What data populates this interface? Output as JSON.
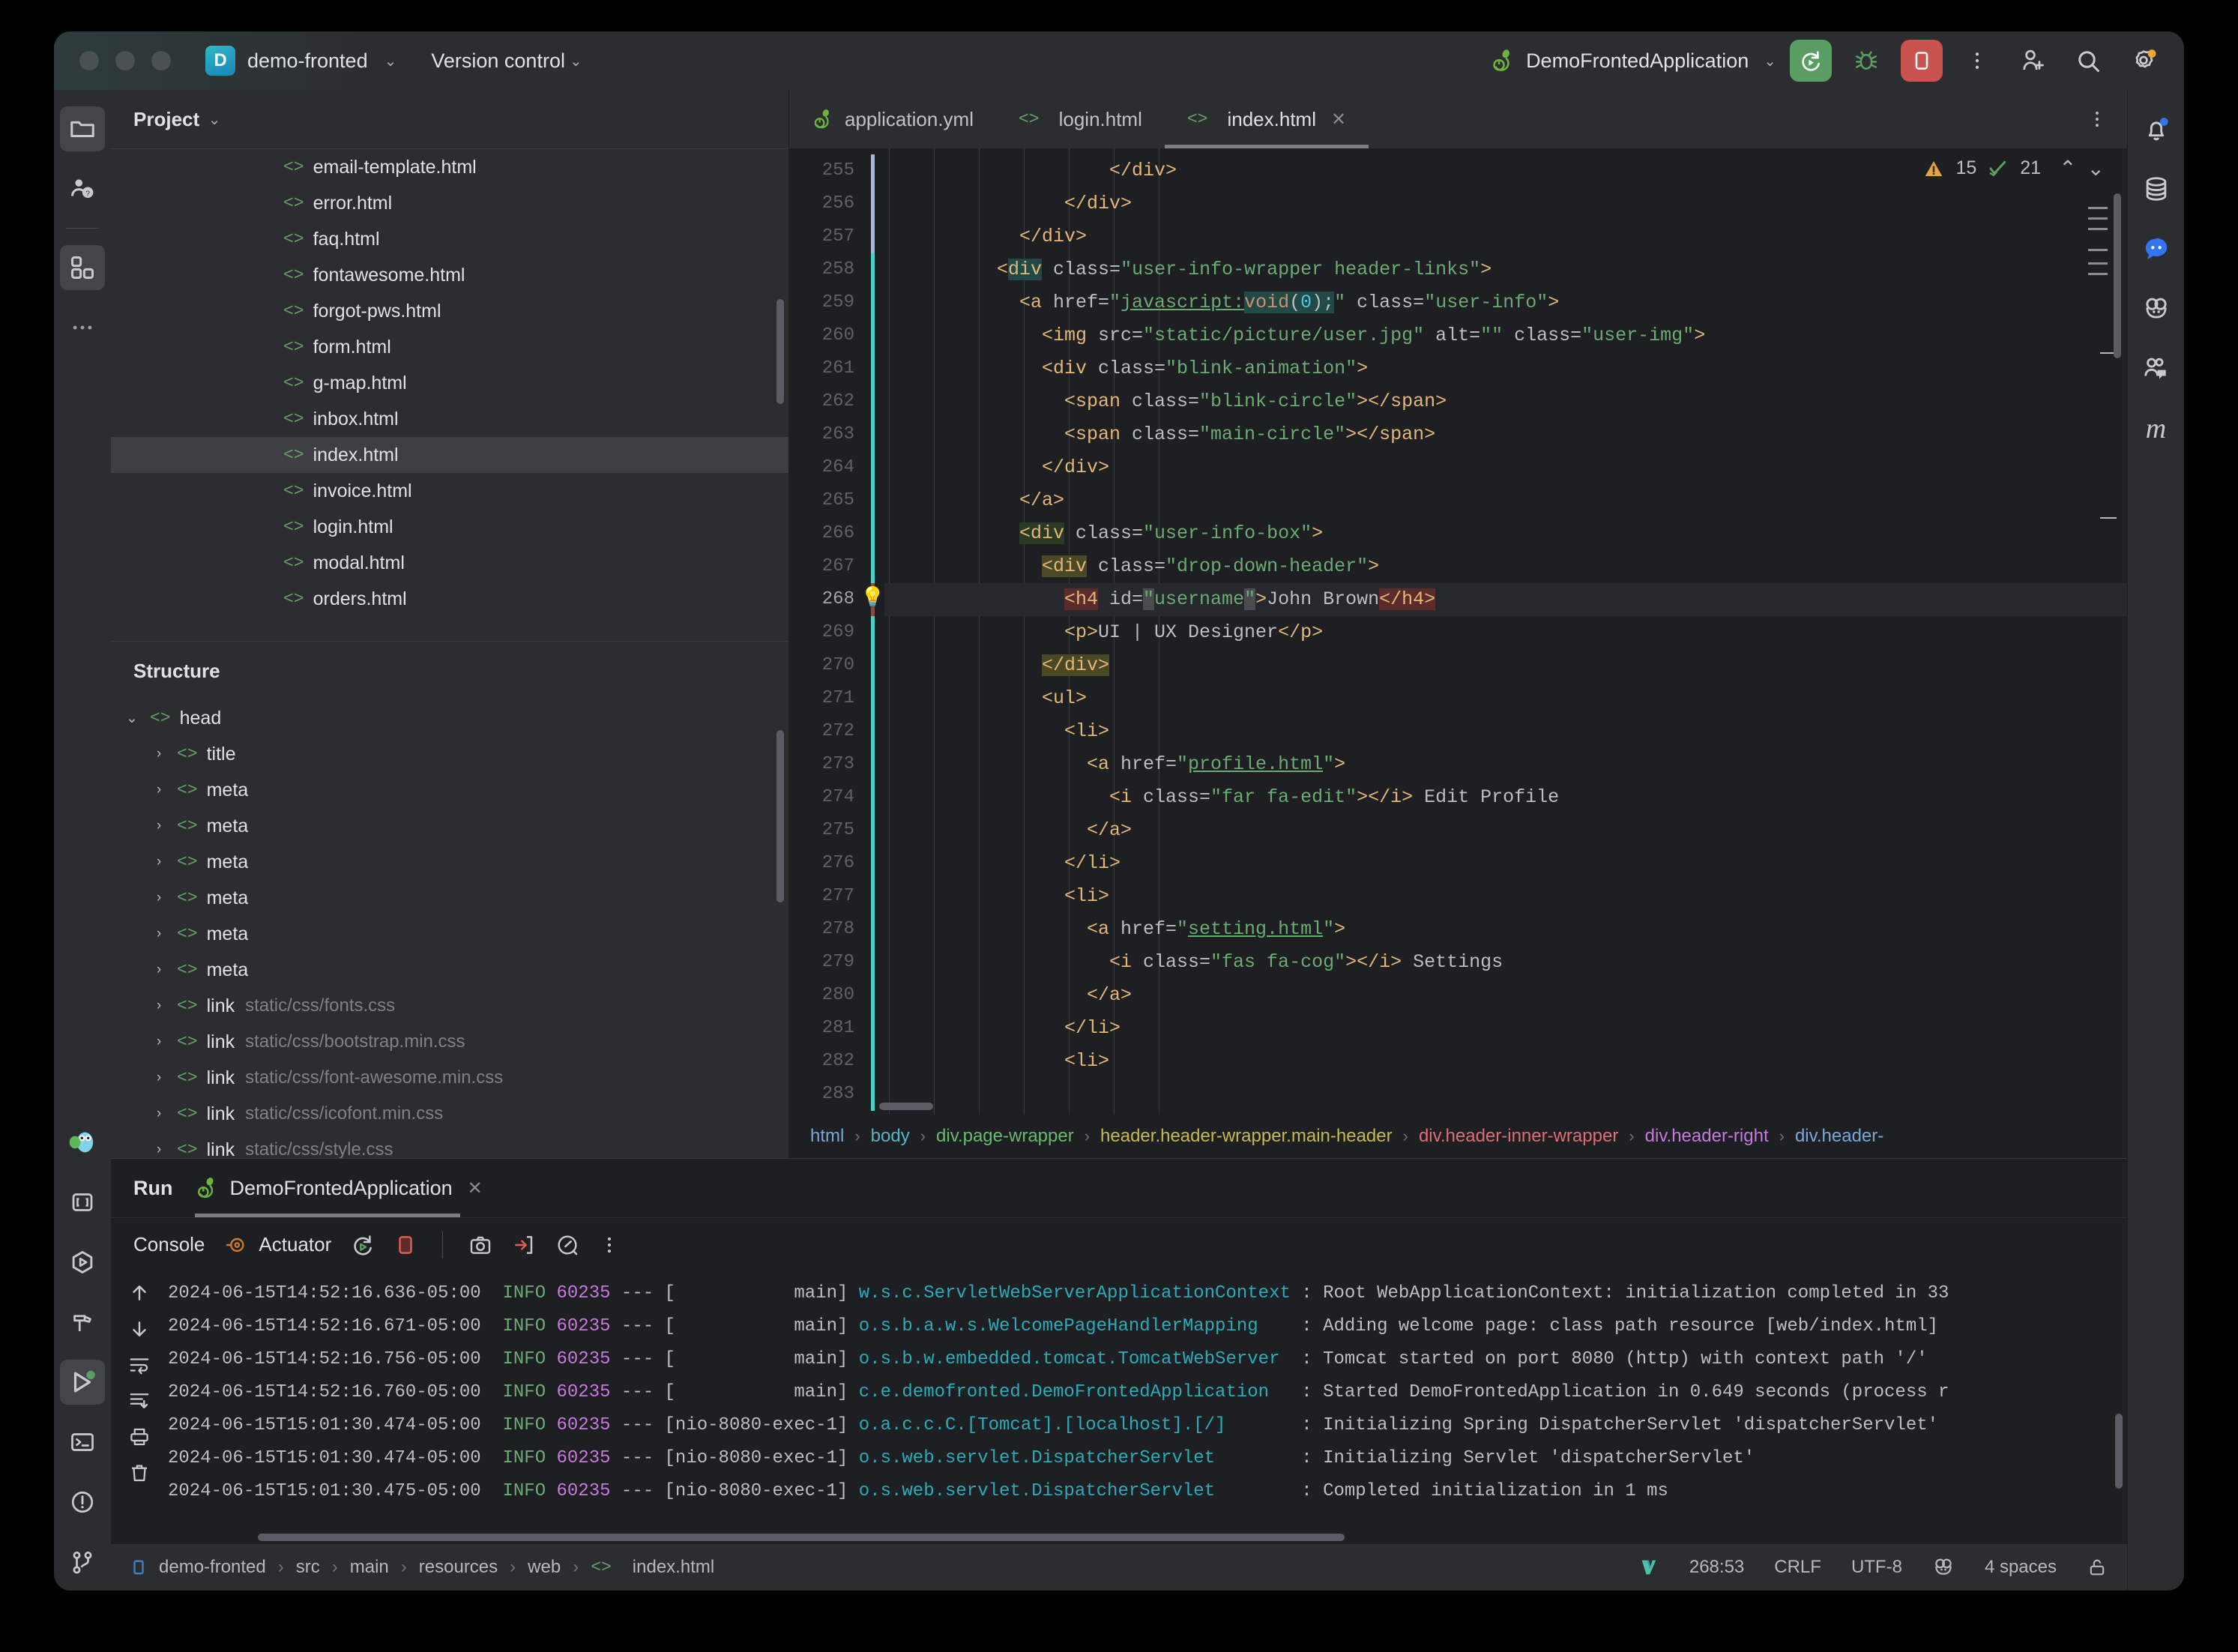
{
  "titlebar": {
    "project_badge": "D",
    "project_name": "demo-fronted",
    "vcs_label": "Version control",
    "run_config": "DemoFrontedApplication",
    "chevron": "⌄"
  },
  "left_rail": {
    "items": [
      {
        "name": "project-folder-icon",
        "active": true
      },
      {
        "name": "ai-assistant-icon",
        "active": false
      },
      {
        "name": "plugins-grid-icon",
        "active": true
      },
      {
        "name": "more-tools-icon",
        "active": false
      }
    ],
    "bottom_items": [
      {
        "name": "go-gopher-icon",
        "active": false
      },
      {
        "name": "bookmarks-icon",
        "active": false
      },
      {
        "name": "run-anything-icon",
        "active": false
      },
      {
        "name": "build-hammer-icon",
        "active": false
      },
      {
        "name": "run-tool-window-icon",
        "active": true
      },
      {
        "name": "terminal-icon",
        "active": false
      },
      {
        "name": "problems-icon",
        "active": false
      },
      {
        "name": "version-control-icon",
        "active": false
      }
    ]
  },
  "right_rail": {
    "items": [
      {
        "name": "notifications-bell-icon",
        "badge": true
      },
      {
        "name": "database-icon",
        "badge": false
      },
      {
        "name": "ai-chat-icon",
        "badge": false
      },
      {
        "name": "gradle-icon",
        "badge": false
      },
      {
        "name": "code-with-me-icon",
        "badge": false
      },
      {
        "name": "maven-icon",
        "badge": false,
        "glyph": "m"
      }
    ]
  },
  "project_panel": {
    "title": "Project",
    "files": [
      "email-template.html",
      "error.html",
      "faq.html",
      "fontawesome.html",
      "forgot-pws.html",
      "form.html",
      "g-map.html",
      "inbox.html",
      "index.html",
      "invoice.html",
      "login.html",
      "modal.html",
      "orders.html"
    ],
    "selected": "index.html"
  },
  "structure_panel": {
    "title": "Structure",
    "nodes": [
      {
        "arrow": "⌄",
        "tag": "head",
        "detail": "",
        "depth": 0
      },
      {
        "arrow": "›",
        "tag": "title",
        "detail": "",
        "depth": 1
      },
      {
        "arrow": "›",
        "tag": "meta",
        "detail": "",
        "depth": 1
      },
      {
        "arrow": "›",
        "tag": "meta",
        "detail": "",
        "depth": 1
      },
      {
        "arrow": "›",
        "tag": "meta",
        "detail": "",
        "depth": 1
      },
      {
        "arrow": "›",
        "tag": "meta",
        "detail": "",
        "depth": 1
      },
      {
        "arrow": "›",
        "tag": "meta",
        "detail": "",
        "depth": 1
      },
      {
        "arrow": "›",
        "tag": "meta",
        "detail": "",
        "depth": 1
      },
      {
        "arrow": "›",
        "tag": "link",
        "detail": "static/css/fonts.css",
        "depth": 1
      },
      {
        "arrow": "›",
        "tag": "link",
        "detail": "static/css/bootstrap.min.css",
        "depth": 1
      },
      {
        "arrow": "›",
        "tag": "link",
        "detail": "static/css/font-awesome.min.css",
        "depth": 1
      },
      {
        "arrow": "›",
        "tag": "link",
        "detail": "static/css/icofont.min.css",
        "depth": 1
      },
      {
        "arrow": "›",
        "tag": "link",
        "detail": "static/css/style.css",
        "depth": 1
      }
    ]
  },
  "editor_tabs": [
    {
      "label": "application.yml",
      "icon": "spring-leaf-icon",
      "active": false,
      "closable": false
    },
    {
      "label": "login.html",
      "icon": "html-icon",
      "active": false,
      "closable": false
    },
    {
      "label": "index.html",
      "icon": "html-icon",
      "active": true,
      "closable": true
    }
  ],
  "inspections": {
    "warning_count": "15",
    "check_count": "21",
    "up_arrow": "⌃",
    "down_arrow": "⌄"
  },
  "code": {
    "first_line_number": 255,
    "current_line": 268,
    "lines": [
      {
        "n": 255,
        "indent": 10,
        "html": "<span class='tag'>&lt;/div&gt;</span>"
      },
      {
        "n": 256,
        "indent": 8,
        "html": "<span class='tag'>&lt;/div&gt;</span>"
      },
      {
        "n": 257,
        "indent": 6,
        "html": "<span class='tag'>&lt;/div&gt;</span>"
      },
      {
        "n": 258,
        "indent": 5,
        "html": "<span class='tag'>&lt;</span><span class='tag hl-div'>div</span><span class='attr'> class=</span><span class='val'>\"user-info-wrapper header-links\"</span><span class='tag'>&gt;</span>"
      },
      {
        "n": 259,
        "indent": 6,
        "html": "<span class='tag'>&lt;a</span><span class='attr'> href=</span><span class='val'>\"</span><span class='val uline'>javascript:</span><span class='kw-void hl-void'>void</span><span class='punc hl-void'>(</span><span class='num0 hl-void'>0</span><span class='punc hl-void'>);</span><span class='val'>\"</span><span class='attr'> class=</span><span class='val'>\"user-info\"</span><span class='tag'>&gt;</span>"
      },
      {
        "n": 260,
        "indent": 7,
        "html": "<span class='tag'>&lt;img</span><span class='attr'> src=</span><span class='val'>\"static/picture/user.jpg\"</span><span class='attr'> alt=</span><span class='val'>\"\"</span><span class='attr'> class=</span><span class='val'>\"user-img\"</span><span class='tag'>&gt;</span>"
      },
      {
        "n": 261,
        "indent": 7,
        "html": "<span class='tag'>&lt;div</span><span class='attr'> class=</span><span class='val'>\"blink-animation\"</span><span class='tag'>&gt;</span>"
      },
      {
        "n": 262,
        "indent": 8,
        "html": "<span class='tag'>&lt;span</span><span class='attr'> class=</span><span class='val'>\"blink-circle\"</span><span class='tag'>&gt;&lt;/span&gt;</span>"
      },
      {
        "n": 263,
        "indent": 8,
        "html": "<span class='tag'>&lt;span</span><span class='attr'> class=</span><span class='val'>\"main-circle\"</span><span class='tag'>&gt;&lt;/span&gt;</span>"
      },
      {
        "n": 264,
        "indent": 7,
        "html": "<span class='tag'>&lt;/div&gt;</span>"
      },
      {
        "n": 265,
        "indent": 6,
        "html": "<span class='tag'>&lt;/a&gt;</span>"
      },
      {
        "n": 266,
        "indent": 6,
        "html": "<span class='tag hl-green'>&lt;div</span><span class='attr'> class=</span><span class='val'>\"user-info-box\"</span><span class='tag'>&gt;</span>"
      },
      {
        "n": 267,
        "indent": 7,
        "html": "<span class='tag hl-olive'>&lt;div</span><span class='attr'> class=</span><span class='val'>\"drop-down-header\"</span><span class='tag'>&gt;</span>"
      },
      {
        "n": 268,
        "indent": 8,
        "html": "<span class='tag hl-red'>&lt;h4</span><span class='attr'> id=</span><span class='val hl-grey'>\"</span><span class='val'>username</span><span class='val hl-grey'>\"</span><span class='tag'>&gt;</span><span class='punc'>John Brown</span><span class='tag hl-red'>&lt;/h4&gt;</span>"
      },
      {
        "n": 269,
        "indent": 8,
        "html": "<span class='tag'>&lt;p&gt;</span><span class='punc'>UI | UX Designer</span><span class='tag'>&lt;/p&gt;</span>"
      },
      {
        "n": 270,
        "indent": 7,
        "html": "<span class='tag hl-olive'>&lt;/div&gt;</span>"
      },
      {
        "n": 271,
        "indent": 7,
        "html": "<span class='tag'>&lt;ul&gt;</span>"
      },
      {
        "n": 272,
        "indent": 8,
        "html": "<span class='tag'>&lt;li&gt;</span>"
      },
      {
        "n": 273,
        "indent": 9,
        "html": "<span class='tag'>&lt;a</span><span class='attr'> href=</span><span class='val'>\"</span><span class='val uline'>profile.html</span><span class='val'>\"</span><span class='tag'>&gt;</span>"
      },
      {
        "n": 274,
        "indent": 10,
        "html": "<span class='tag'>&lt;i</span><span class='attr'> class=</span><span class='val'>\"far fa-edit\"</span><span class='tag'>&gt;&lt;/i&gt;</span><span class='punc'> Edit Profile</span>"
      },
      {
        "n": 275,
        "indent": 9,
        "html": "<span class='tag'>&lt;/a&gt;</span>"
      },
      {
        "n": 276,
        "indent": 8,
        "html": "<span class='tag'>&lt;/li&gt;</span>"
      },
      {
        "n": 277,
        "indent": 8,
        "html": "<span class='tag'>&lt;li&gt;</span>"
      },
      {
        "n": 278,
        "indent": 9,
        "html": "<span class='tag'>&lt;a</span><span class='attr'> href=</span><span class='val'>\"</span><span class='val uline'>setting.html</span><span class='val'>\"</span><span class='tag'>&gt;</span>"
      },
      {
        "n": 279,
        "indent": 10,
        "html": "<span class='tag'>&lt;i</span><span class='attr'> class=</span><span class='val'>\"fas fa-cog\"</span><span class='tag'>&gt;&lt;/i&gt;</span><span class='punc'> Settings</span>"
      },
      {
        "n": 280,
        "indent": 9,
        "html": "<span class='tag'>&lt;/a&gt;</span>"
      },
      {
        "n": 281,
        "indent": 8,
        "html": "<span class='tag'>&lt;/li&gt;</span>"
      },
      {
        "n": 282,
        "indent": 8,
        "html": "<span class='tag'>&lt;li&gt;</span>"
      },
      {
        "n": 283,
        "indent": 8,
        "html": ""
      }
    ]
  },
  "breadcrumbs": [
    {
      "label": "html",
      "color": "#7aa6da"
    },
    {
      "label": "body",
      "color": "#56b6c2"
    },
    {
      "label": "div.page-wrapper",
      "color": "#66bb6a"
    },
    {
      "label": "header.header-wrapper.main-header",
      "color": "#c5b94c"
    },
    {
      "label": "div.header-inner-wrapper",
      "color": "#e06c75"
    },
    {
      "label": "div.header-right",
      "color": "#c678dd"
    },
    {
      "label": "div.header-",
      "color": "#7aa6da"
    }
  ],
  "run_panel": {
    "title": "Run",
    "tab_label": "DemoFrontedApplication",
    "console_label": "Console",
    "actuator_label": "Actuator",
    "toolbar_icons": [
      "rerun-icon",
      "stop-icon",
      "camera-icon",
      "export-icon",
      "profiler-icon",
      "more-icon"
    ],
    "side_icons": [
      "scroll-up-icon",
      "scroll-down-icon",
      "soft-wrap-icon",
      "scroll-to-end-icon",
      "print-icon",
      "clear-all-icon"
    ],
    "log_lines": [
      {
        "ts": "2024-06-15T14:52:16.636-05:00",
        "level": "INFO",
        "pid": "60235",
        "thread": "           main",
        "cls": "w.s.c.ServletWebServerApplicationContext",
        "msg": ": Root WebApplicationContext: initialization completed in 33"
      },
      {
        "ts": "2024-06-15T14:52:16.671-05:00",
        "level": "INFO",
        "pid": "60235",
        "thread": "           main",
        "cls": "o.s.b.a.w.s.WelcomePageHandlerMapping   ",
        "msg": ": Adding welcome page: class path resource [web/index.html]"
      },
      {
        "ts": "2024-06-15T14:52:16.756-05:00",
        "level": "INFO",
        "pid": "60235",
        "thread": "           main",
        "cls": "o.s.b.w.embedded.tomcat.TomcatWebServer ",
        "msg": ": Tomcat started on port 8080 (http) with context path '/'"
      },
      {
        "ts": "2024-06-15T14:52:16.760-05:00",
        "level": "INFO",
        "pid": "60235",
        "thread": "           main",
        "cls": "c.e.demofronted.DemoFrontedApplication  ",
        "msg": ": Started DemoFrontedApplication in 0.649 seconds (process r"
      },
      {
        "ts": "2024-06-15T15:01:30.474-05:00",
        "level": "INFO",
        "pid": "60235",
        "thread": "nio-8080-exec-1",
        "cls": "o.a.c.c.C.[Tomcat].[localhost].[/]      ",
        "msg": ": Initializing Spring DispatcherServlet 'dispatcherServlet'"
      },
      {
        "ts": "2024-06-15T15:01:30.474-05:00",
        "level": "INFO",
        "pid": "60235",
        "thread": "nio-8080-exec-1",
        "cls": "o.s.web.servlet.DispatcherServlet       ",
        "msg": ": Initializing Servlet 'dispatcherServlet'"
      },
      {
        "ts": "2024-06-15T15:01:30.475-05:00",
        "level": "INFO",
        "pid": "60235",
        "thread": "nio-8080-exec-1",
        "cls": "o.s.web.servlet.DispatcherServlet       ",
        "msg": ": Completed initialization in 1 ms"
      }
    ]
  },
  "statusbar": {
    "crumbs": [
      "demo-fronted",
      "src",
      "main",
      "resources",
      "web"
    ],
    "file": "index.html",
    "caret": "268:53",
    "line_separator": "CRLF",
    "encoding": "UTF-8",
    "indent": "4 spaces",
    "separator": "›"
  }
}
